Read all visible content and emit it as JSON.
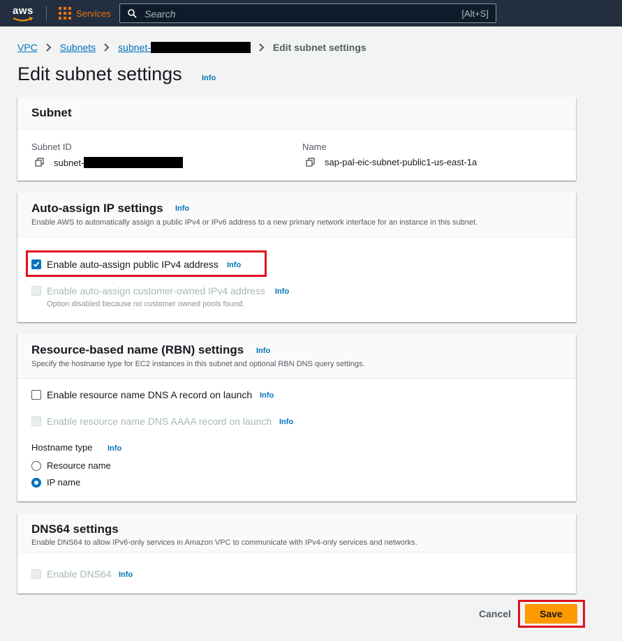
{
  "nav": {
    "logo_text": "aws",
    "services_label": "Services",
    "search_placeholder": "Search",
    "search_shortcut": "[Alt+S]"
  },
  "breadcrumb": {
    "items": [
      "VPC",
      "Subnets",
      "subnet-"
    ],
    "current": "Edit subnet settings"
  },
  "page": {
    "title": "Edit subnet settings",
    "info": "Info"
  },
  "subnet_panel": {
    "title": "Subnet",
    "subnet_id_label": "Subnet ID",
    "subnet_id_value": "subnet-",
    "name_label": "Name",
    "name_value": "sap-pal-eic-subnet-public1-us-east-1a"
  },
  "auto_assign_panel": {
    "title": "Auto-assign IP settings",
    "info": "Info",
    "description": "Enable AWS to automatically assign a public IPv4 or IPv6 address to a new primary network interface for an instance in this subnet.",
    "ipv4_label": "Enable auto-assign public IPv4 address",
    "ipv4_checked": true,
    "customer_owned_label": "Enable auto-assign customer-owned IPv4 address",
    "customer_owned_sub": "Option disabled because no customer owned pools found."
  },
  "rbn_panel": {
    "title": "Resource-based name (RBN) settings",
    "info": "Info",
    "description": "Specify the hostname type for EC2 instances in this subnet and optional RBN DNS query settings.",
    "dns_a_label": "Enable resource name DNS A record on launch",
    "dns_aaaa_label": "Enable resource name DNS AAAA record on launch",
    "hostname_type_label": "Hostname type",
    "hostname_options": [
      "Resource name",
      "IP name"
    ],
    "hostname_selected": "IP name"
  },
  "dns64_panel": {
    "title": "DNS64 settings",
    "description": "Enable DNS64 to allow IPv6-only services in Amazon VPC to communicate with IPv4-only services and networks.",
    "enable_label": "Enable DNS64",
    "info": "Info"
  },
  "footer": {
    "cancel_label": "Cancel",
    "save_label": "Save"
  },
  "colors": {
    "nav_bg": "#232f3e",
    "accent_orange": "#ff9900",
    "link_blue": "#0073bb",
    "highlight_red": "#e0101f"
  }
}
